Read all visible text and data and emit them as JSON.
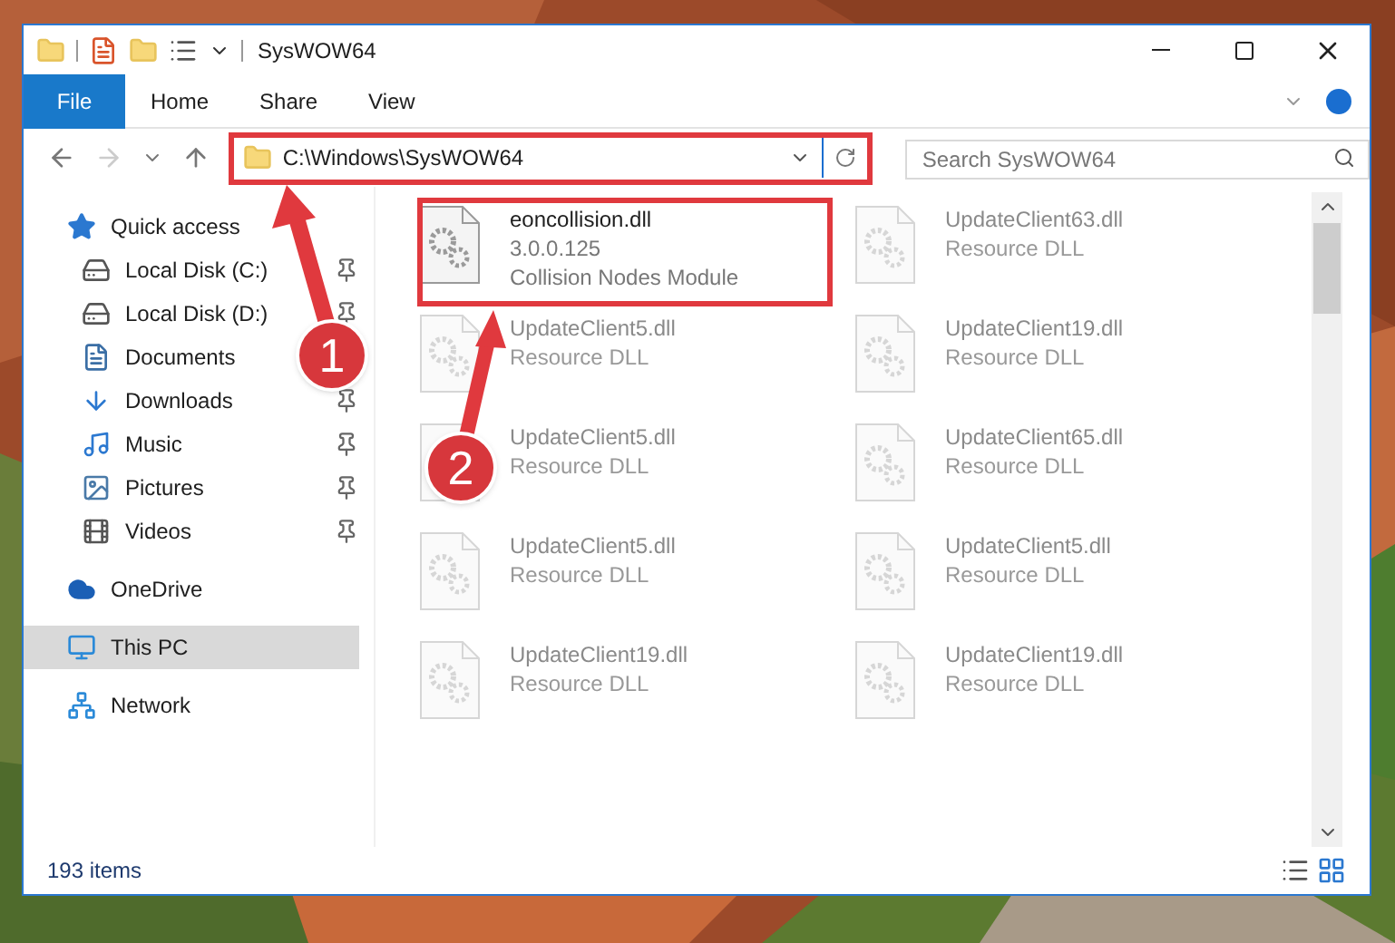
{
  "window": {
    "title": "SysWOW64"
  },
  "ribbon_tabs": [
    {
      "label": "File",
      "kind": "file"
    },
    {
      "label": "Home",
      "kind": "tab"
    },
    {
      "label": "Share",
      "kind": "tab"
    },
    {
      "label": "View",
      "kind": "tab"
    }
  ],
  "address_bar": {
    "path": "C:\\Windows\\SysWOW64"
  },
  "search": {
    "placeholder": "Search SysWOW64"
  },
  "nav": [
    {
      "label": "Quick access",
      "kind": "star",
      "selected": false,
      "children": [
        {
          "label": "Local Disk (C:)",
          "kind": "drive",
          "pinned": true,
          "selected": false
        },
        {
          "label": "Local Disk (D:)",
          "kind": "drive",
          "pinned": true,
          "selected": false
        },
        {
          "label": "Documents",
          "kind": "documents",
          "selected": false
        },
        {
          "label": "Downloads",
          "kind": "downloads",
          "pinned": true,
          "selected": false
        },
        {
          "label": "Music",
          "kind": "music",
          "pinned": true,
          "selected": false
        },
        {
          "label": "Pictures",
          "kind": "pictures",
          "pinned": true,
          "selected": false
        },
        {
          "label": "Videos",
          "kind": "videos",
          "pinned": true,
          "selected": false
        }
      ]
    },
    {
      "label": "OneDrive",
      "kind": "cloud",
      "selected": false
    },
    {
      "label": "This PC",
      "kind": "pc",
      "selected": true
    },
    {
      "label": "Network",
      "kind": "network",
      "selected": false
    }
  ],
  "files": [
    {
      "name": "eoncollision.dll",
      "details": [
        "3.0.0.125",
        "Collision Nodes Module"
      ],
      "blurred": false
    },
    {
      "name": "UpdateClient63.dll",
      "details": [
        "Resource DLL"
      ],
      "blurred": true
    },
    {
      "name": "UpdateClient5.dll",
      "details": [
        "Resource DLL"
      ],
      "blurred": true
    },
    {
      "name": "UpdateClient19.dll",
      "details": [
        "Resource DLL"
      ],
      "blurred": true
    },
    {
      "name": "UpdateClient5.dll",
      "details": [
        "Resource DLL"
      ],
      "blurred": true
    },
    {
      "name": "UpdateClient65.dll",
      "details": [
        "Resource DLL"
      ],
      "blurred": true
    },
    {
      "name": "UpdateClient5.dll",
      "details": [
        "Resource DLL"
      ],
      "blurred": true
    },
    {
      "name": "UpdateClient5.dll",
      "details": [
        "Resource DLL"
      ],
      "blurred": true
    },
    {
      "name": "UpdateClient19.dll",
      "details": [
        "Resource DLL"
      ],
      "blurred": true
    },
    {
      "name": "UpdateClient19.dll",
      "details": [
        "Resource DLL"
      ],
      "blurred": true
    }
  ],
  "status_bar": {
    "count": "193 items"
  },
  "annotations": [
    {
      "number": "1"
    },
    {
      "number": "2"
    }
  ]
}
